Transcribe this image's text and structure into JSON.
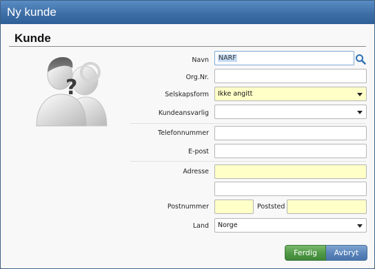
{
  "window": {
    "title": "Ny kunde"
  },
  "section": {
    "title": "Kunde"
  },
  "form": {
    "name": {
      "label": "Navn",
      "value": "NARF"
    },
    "orgnr": {
      "label": "Org.Nr.",
      "value": ""
    },
    "company_form": {
      "label": "Selskapsform",
      "value": "Ikke angitt"
    },
    "account_manager": {
      "label": "Kundeansvarlig",
      "value": ""
    },
    "phone": {
      "label": "Telefonnummer",
      "value": ""
    },
    "email": {
      "label": "E-post",
      "value": ""
    },
    "address": {
      "label": "Adresse",
      "line1": "",
      "line2": ""
    },
    "postal_code": {
      "label": "Postnummer",
      "value": ""
    },
    "city": {
      "label": "Poststed",
      "value": ""
    },
    "country": {
      "label": "Land",
      "value": "Norge"
    }
  },
  "buttons": {
    "done": "Ferdig",
    "cancel": "Avbryt"
  },
  "icons": {
    "avatar": "unknown-user-icon",
    "search": "search-icon",
    "dropdown": "chevron-down-icon"
  },
  "colors": {
    "titlebar": "#3f6fa7",
    "required_field": "#ffffc8",
    "primary_button": "#4f9845",
    "secondary_button": "#5883ba"
  }
}
